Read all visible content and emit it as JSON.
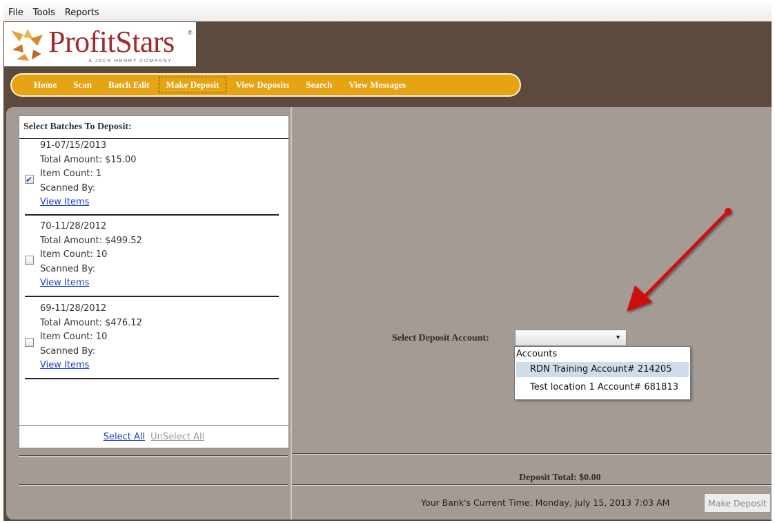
{
  "menu": {
    "items": [
      "File",
      "Tools",
      "Reports"
    ]
  },
  "logo": {
    "name": "ProfitStars",
    "reg": "®",
    "tagline": "A JACK HENRY COMPANY"
  },
  "nav": {
    "items": [
      "Home",
      "Scan",
      "Batch Edit",
      "Make Deposit",
      "View Deposits",
      "Search",
      "View Messages"
    ],
    "active": "Make Deposit"
  },
  "batches": {
    "title": "Select Batches To Deposit:",
    "list": [
      {
        "id": "91-07/15/2013",
        "total": "Total Amount: $15.00",
        "count": "Item Count: 1",
        "scanned": "Scanned By:",
        "link": "View Items",
        "checked": true
      },
      {
        "id": "70-11/28/2012",
        "total": "Total Amount: $499.52",
        "count": "Item Count: 10",
        "scanned": "Scanned By:",
        "link": "View Items",
        "checked": false
      },
      {
        "id": "69-11/28/2012",
        "total": "Total Amount: $476.12",
        "count": "Item Count: 10",
        "scanned": "Scanned By:",
        "link": "View Items",
        "checked": false
      }
    ],
    "select_all": "Select All",
    "unselect_all": "UnSelect All"
  },
  "deposit_account": {
    "label": "Select Deposit Account:",
    "selected": "",
    "dropdown_header": "Accounts",
    "options": [
      "RDN Training Account# 214205",
      "Test location 1 Account# 681813"
    ],
    "highlighted_option": "RDN Training Account# 214205"
  },
  "deposit_total": "Deposit Total:  $0.00",
  "bank_time": "Your Bank's Current Time: Monday, July 15, 2013 7:03 AM",
  "make_deposit_button": "Make Deposit",
  "colors": {
    "brown_frame": "#5b4a3d",
    "content_bg": "#a39b94",
    "nav_gold": "#e6a313",
    "logo_red": "#a22a2f",
    "arrow_red": "#d01010"
  }
}
